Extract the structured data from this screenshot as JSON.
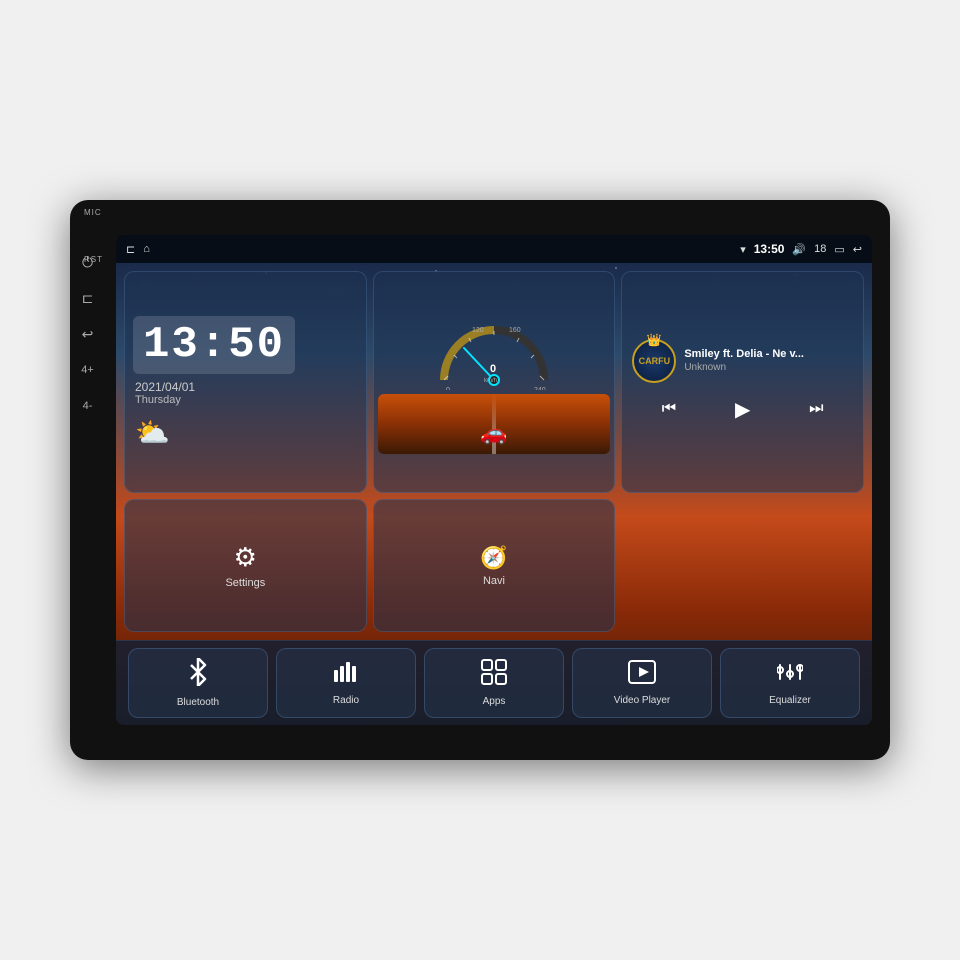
{
  "device": {
    "label": "Car Head Unit"
  },
  "status_bar": {
    "left_icons": [
      "⊏",
      "⌂"
    ],
    "time": "13:50",
    "volume_icon": "🔊",
    "volume_level": "18",
    "battery_icon": "▭",
    "back_icon": "↩",
    "wifi_icon": "▼"
  },
  "side_labels": {
    "mic": "MIC",
    "rst": "RST"
  },
  "side_buttons": [
    "⏻",
    "⊏",
    "↩",
    "4+",
    "4-"
  ],
  "clock": {
    "time": "13:50",
    "date": "2021/04/01",
    "day": "Thursday",
    "weather": "⛅"
  },
  "music": {
    "title": "Smiley ft. Delia - Ne v...",
    "artist": "Unknown",
    "logo_text": "CARFU",
    "crown": "👑",
    "prev": "⏮",
    "play": "▶",
    "next": "⏭"
  },
  "speed": {
    "unit": "km/h",
    "value": "0"
  },
  "settings_card": {
    "icon": "⚙",
    "label": "Settings"
  },
  "navi_card": {
    "icon": "▲",
    "label": "Navi"
  },
  "bottom_items": [
    {
      "id": "bluetooth",
      "icon": "bluetooth",
      "label": "Bluetooth"
    },
    {
      "id": "radio",
      "icon": "radio",
      "label": "Radio"
    },
    {
      "id": "apps",
      "icon": "apps",
      "label": "Apps"
    },
    {
      "id": "video-player",
      "icon": "video",
      "label": "Video Player"
    },
    {
      "id": "equalizer",
      "icon": "equalizer",
      "label": "Equalizer"
    }
  ]
}
